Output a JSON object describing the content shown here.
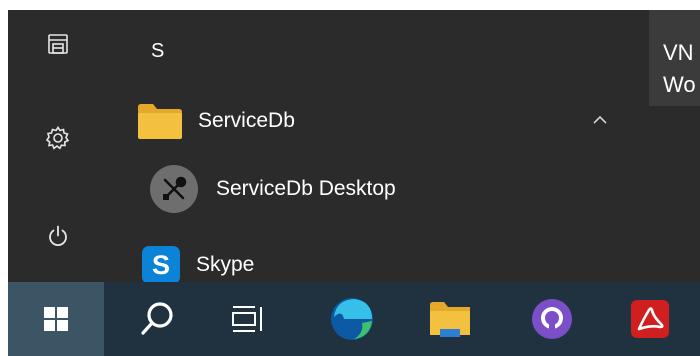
{
  "start_menu": {
    "letter_header": "S",
    "folder": {
      "label": "ServiceDb",
      "icon": "folder-icon",
      "expanded": true
    },
    "folder_children": [
      {
        "label": "ServiceDb Desktop",
        "icon": "tools-icon"
      }
    ],
    "apps": [
      {
        "label": "Skype",
        "icon": "skype-icon",
        "glyph": "S"
      }
    ],
    "rail": [
      {
        "icon": "pictures-icon"
      },
      {
        "icon": "settings-gear-icon"
      },
      {
        "icon": "power-icon"
      }
    ]
  },
  "side_panel": {
    "line1": "VN",
    "line2": "Wo"
  },
  "taskbar": {
    "items": [
      {
        "icon": "windows-logo-icon"
      },
      {
        "icon": "search-icon"
      },
      {
        "icon": "task-view-icon"
      },
      {
        "icon": "edge-browser-icon"
      },
      {
        "icon": "file-explorer-icon"
      },
      {
        "icon": "github-desktop-icon"
      },
      {
        "icon": "acrobat-reader-icon"
      }
    ]
  },
  "colors": {
    "menu_bg": "#2b2b2b",
    "taskbar_bg": "#203240",
    "start_hover": "#3c5564",
    "folder_yellow": "#f4c040",
    "skype_blue": "#0b84d8"
  }
}
